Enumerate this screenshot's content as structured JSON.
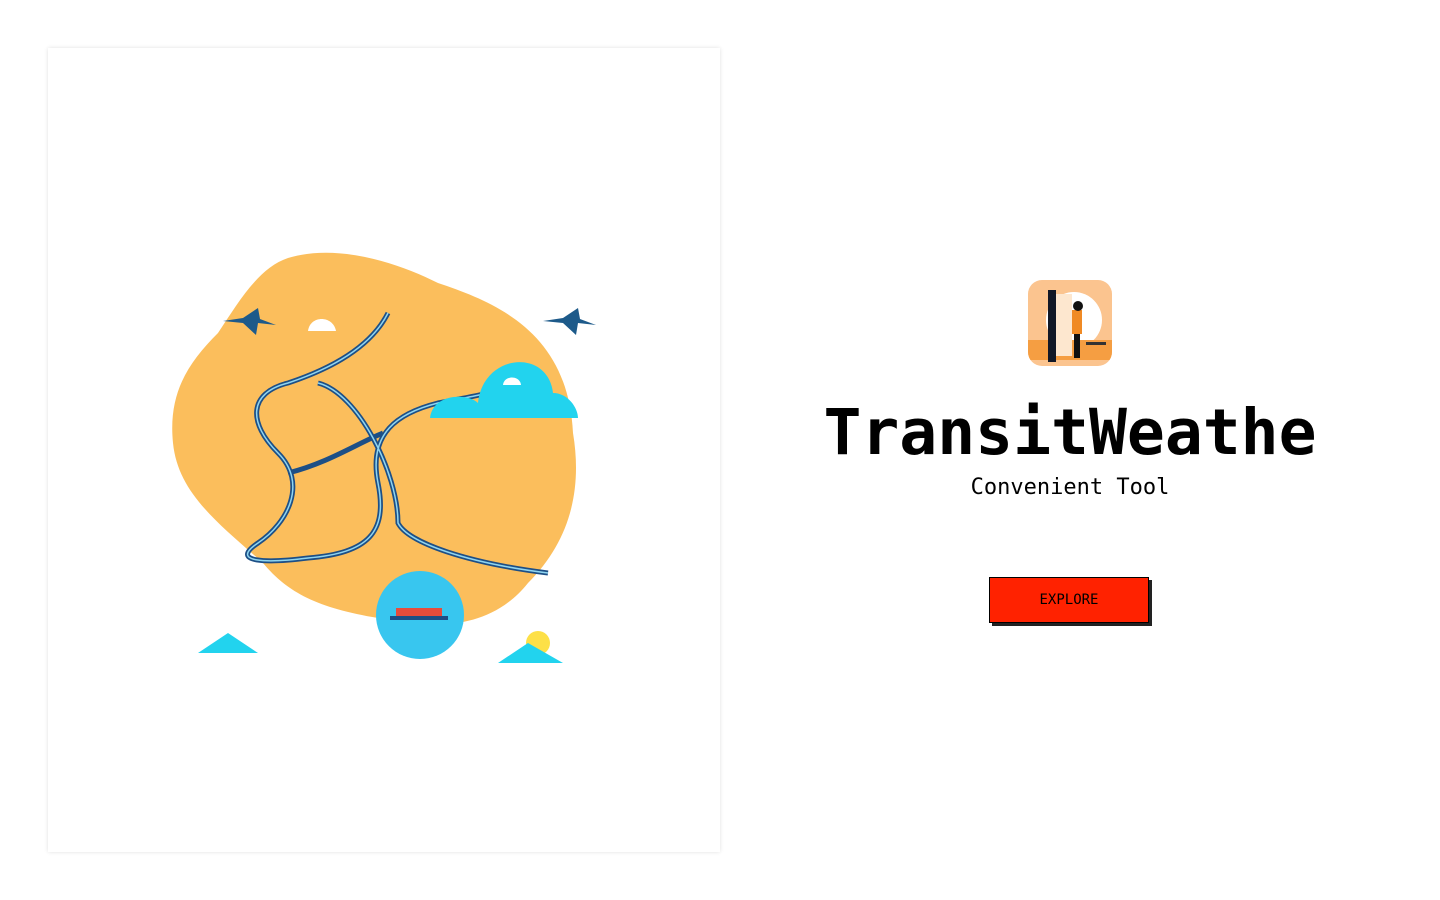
{
  "hero": {
    "title": "TransitWeathe",
    "subtitle": "Convenient Tool",
    "explore_label": "EXPLORE",
    "button_color": "#ff2200"
  },
  "illustration": {
    "subject": "transit-map-icon"
  },
  "logo": {
    "subject": "app-logo-icon"
  }
}
